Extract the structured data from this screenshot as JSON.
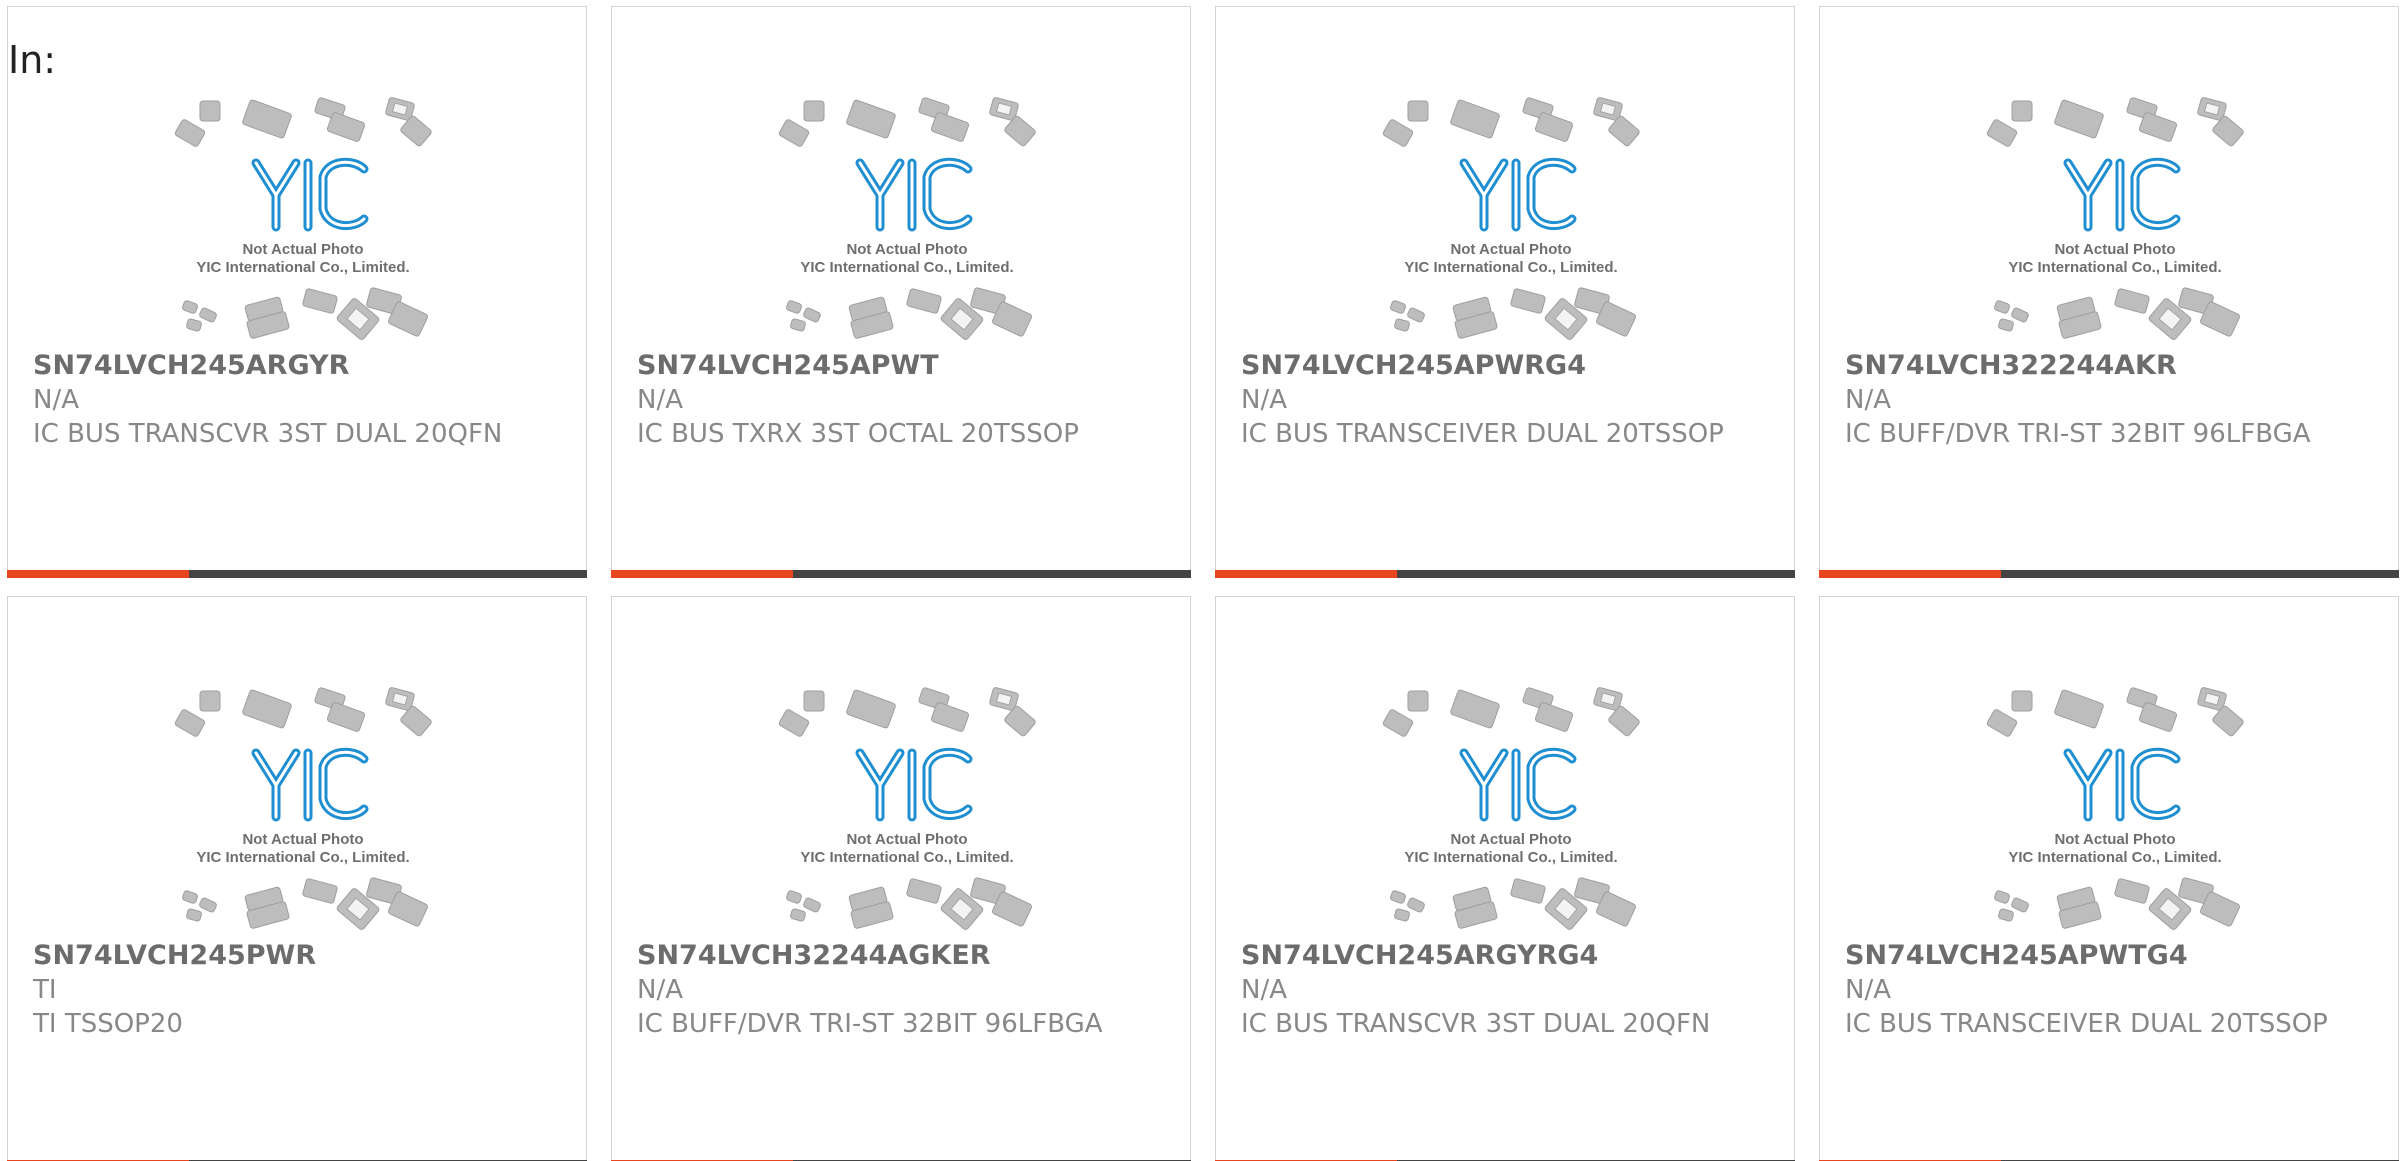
{
  "header": {
    "label": "In:"
  },
  "thumbnail": {
    "caption_line1": "Not Actual Photo",
    "caption_line2": "YIC International Co., Limited.",
    "logo_text": "YIC",
    "logo_color": "#1f8fd1"
  },
  "colors": {
    "accent": "#e8461e",
    "bar": "#444444",
    "border": "#d4d4d4"
  },
  "products": [
    {
      "part": "SN74LVCH245ARGYR",
      "manufacturer": "N/A",
      "description": "IC BUS TRANSCVR 3ST DUAL 20QFN"
    },
    {
      "part": "SN74LVCH245APWT",
      "manufacturer": "N/A",
      "description": "IC BUS TXRX 3ST OCTAL 20TSSOP"
    },
    {
      "part": "SN74LVCH245APWRG4",
      "manufacturer": "N/A",
      "description": "IC BUS TRANSCEIVER DUAL 20TSSOP"
    },
    {
      "part": "SN74LVCH322244AKR",
      "manufacturer": "N/A",
      "description": "IC BUFF/DVR TRI-ST 32BIT 96LFBGA"
    },
    {
      "part": "SN74LVCH245PWR",
      "manufacturer": "TI",
      "description": "TI TSSOP20"
    },
    {
      "part": "SN74LVCH32244AGKER",
      "manufacturer": "N/A",
      "description": "IC BUFF/DVR TRI-ST 32BIT 96LFBGA"
    },
    {
      "part": "SN74LVCH245ARGYRG4",
      "manufacturer": "N/A",
      "description": "IC BUS TRANSCVR 3ST DUAL 20QFN"
    },
    {
      "part": "SN74LVCH245APWTG4",
      "manufacturer": "N/A",
      "description": "IC BUS TRANSCEIVER DUAL 20TSSOP"
    }
  ]
}
